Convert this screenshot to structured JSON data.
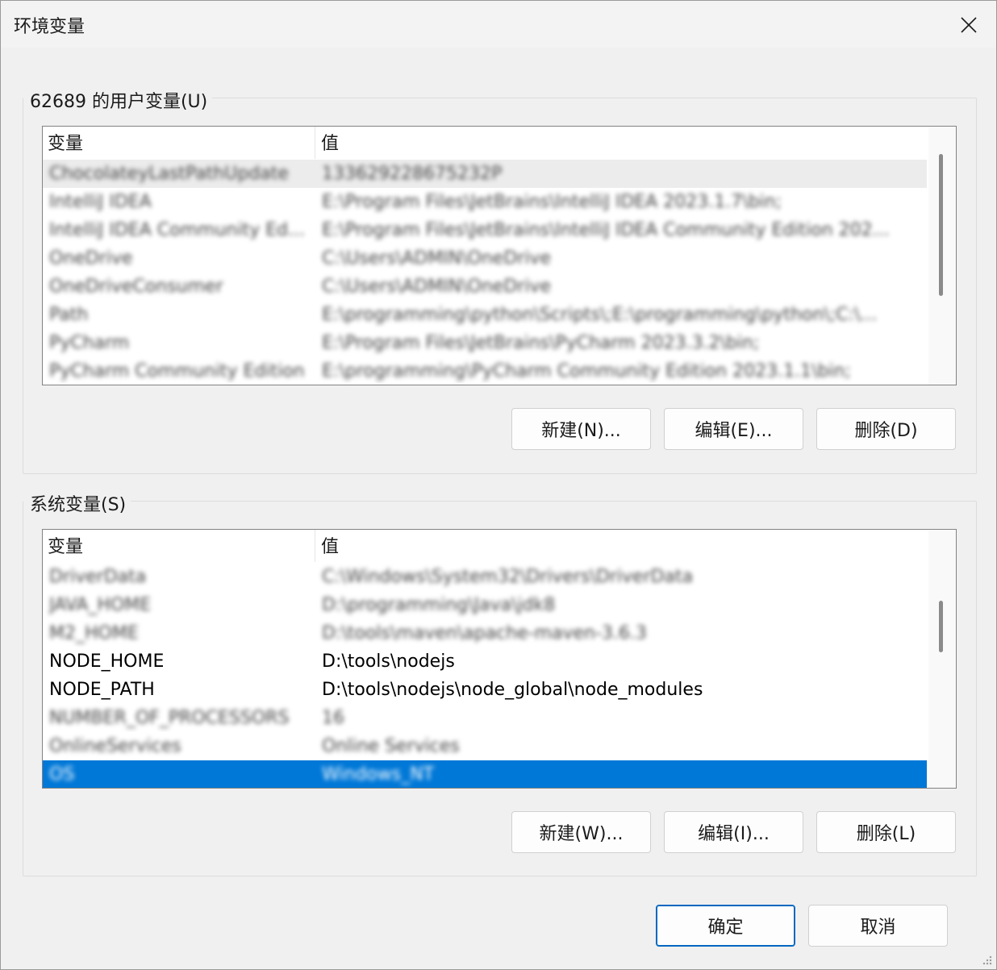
{
  "window": {
    "title": "环境变量",
    "close_icon": "close-icon"
  },
  "user_vars": {
    "group_label": "62689 的用户变量(U)",
    "columns": [
      "变量",
      "值"
    ],
    "rows": [
      {
        "name": "ChocolateyLastPathUpdate",
        "value": "133629228675232P",
        "blurred": true,
        "state": "hover"
      },
      {
        "name": "IntelliJ IDEA",
        "value": "E:\\Program Files\\JetBrains\\IntelliJ IDEA 2023.1.7\\bin;",
        "blurred": true
      },
      {
        "name": "IntelliJ IDEA Community Ed...",
        "value": "E:\\Program Files\\JetBrains\\IntelliJ IDEA Community Edition 202...",
        "blurred": true
      },
      {
        "name": "OneDrive",
        "value": "C:\\Users\\ADMIN\\OneDrive",
        "blurred": true
      },
      {
        "name": "OneDriveConsumer",
        "value": "C:\\Users\\ADMIN\\OneDrive",
        "blurred": true
      },
      {
        "name": "Path",
        "value": "E:\\programming\\python\\Scripts\\;E:\\programming\\python\\;C:\\...",
        "blurred": true
      },
      {
        "name": "PyCharm",
        "value": "E:\\Program Files\\JetBrains\\PyCharm 2023.3.2\\bin;",
        "blurred": true
      },
      {
        "name": "PyCharm Community Edition",
        "value": "E:\\programming\\PyCharm Community Edition 2023.1.1\\bin;",
        "blurred": true
      }
    ],
    "buttons": {
      "new": "新建(N)...",
      "edit": "编辑(E)...",
      "delete": "删除(D)"
    }
  },
  "system_vars": {
    "group_label": "系统变量(S)",
    "columns": [
      "变量",
      "值"
    ],
    "rows": [
      {
        "name": "DriverData",
        "value": "C:\\Windows\\System32\\Drivers\\DriverData",
        "blurred": true
      },
      {
        "name": "JAVA_HOME",
        "value": "D:\\programming\\Java\\jdk8",
        "blurred": true
      },
      {
        "name": "M2_HOME",
        "value": "D:\\tools\\maven\\apache-maven-3.6.3",
        "blurred": true
      },
      {
        "name": "NODE_HOME",
        "value": "D:\\tools\\nodejs",
        "blurred": false
      },
      {
        "name": "NODE_PATH",
        "value": "D:\\tools\\nodejs\\node_global\\node_modules",
        "blurred": false
      },
      {
        "name": "NUMBER_OF_PROCESSORS",
        "value": "16",
        "blurred": true
      },
      {
        "name": "OnlineServices",
        "value": "Online Services",
        "blurred": true
      },
      {
        "name": "OS",
        "value": "Windows_NT",
        "blurred": true,
        "state": "selected"
      }
    ],
    "buttons": {
      "new": "新建(W)...",
      "edit": "编辑(I)...",
      "delete": "删除(L)"
    }
  },
  "footer": {
    "ok": "确定",
    "cancel": "取消"
  },
  "colors": {
    "selection": "#0078d7",
    "primary_border": "#0067c0"
  }
}
